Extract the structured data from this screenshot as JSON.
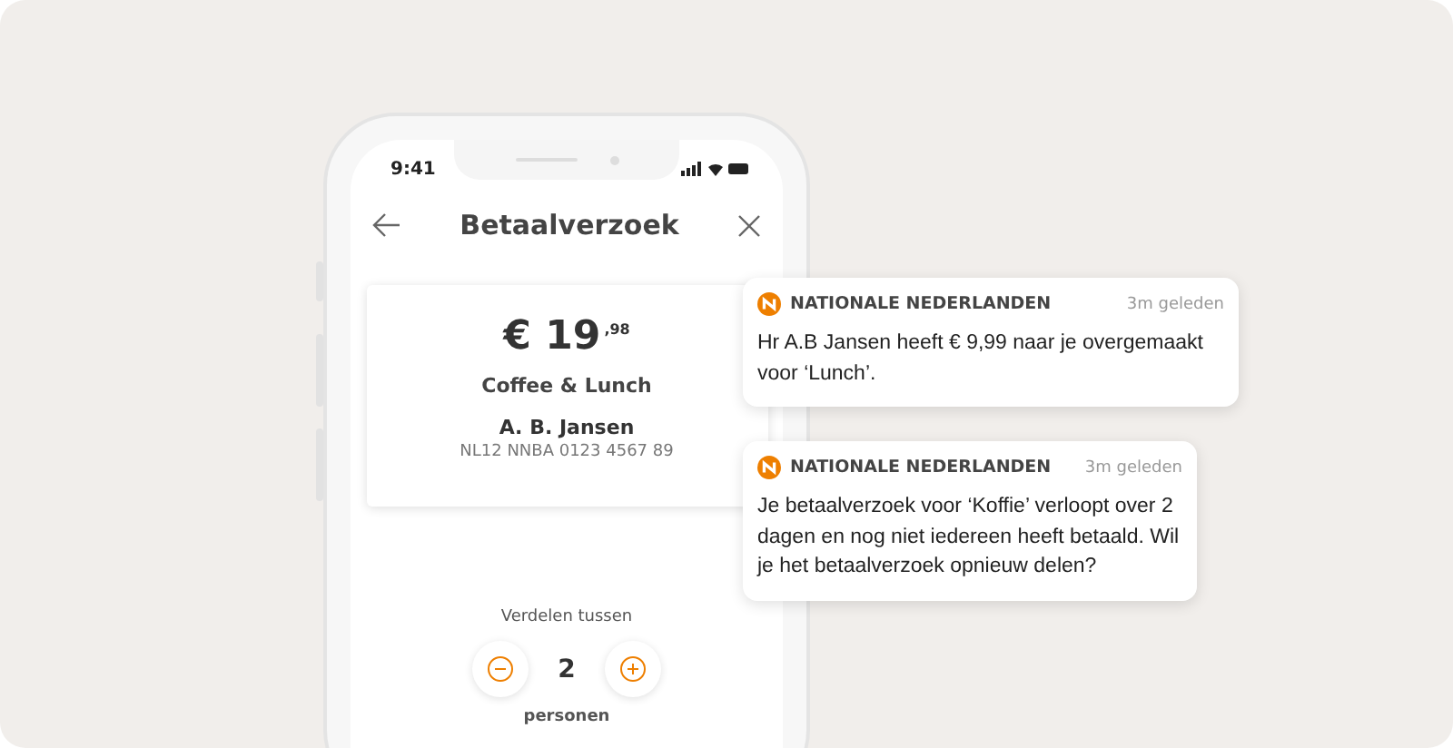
{
  "phone": {
    "status_time": "9:41",
    "header": {
      "title": "Betaalverzoek"
    },
    "card": {
      "amount_whole": "€ 19",
      "amount_cents": ",98",
      "description": "Coffee & Lunch",
      "name": "A. B. Jansen",
      "iban": "NL12 NNBA 0123 4567 89"
    },
    "split": {
      "label": "Verdelen tussen",
      "count": "2",
      "unit": "personen"
    }
  },
  "notifications": [
    {
      "sender": "NATIONALE NEDERLANDEN",
      "time": "3m geleden",
      "message": "Hr A.B Jansen heeft € 9,99 naar je overgemaakt voor ‘Lunch’."
    },
    {
      "sender": "NATIONALE NEDERLANDEN",
      "time": "3m geleden",
      "message": "Je betaalverzoek voor ‘Koffie’ verloopt over 2 dagen en nog niet iedereen heeft betaald. Wil je het betaalverzoek opnieuw delen?"
    }
  ]
}
